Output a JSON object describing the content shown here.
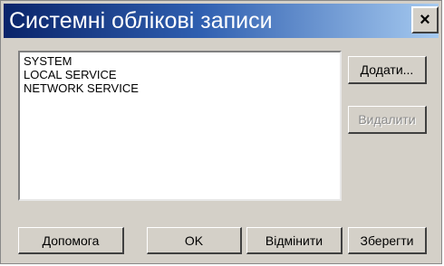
{
  "window": {
    "title": "Системні облікові записи",
    "close_label": "×"
  },
  "accounts": {
    "items": [
      "SYSTEM",
      "LOCAL SERVICE",
      "NETWORK SERVICE"
    ]
  },
  "side_buttons": {
    "add_label": "Додати...",
    "remove_label": "Видалити"
  },
  "footer_buttons": {
    "help_label": "Допомога",
    "ok_label": "OK",
    "cancel_label": "Відмінити",
    "save_label": "Зберегти"
  },
  "colors": {
    "title_start": "#0a246a",
    "title_end": "#a6caf0",
    "face": "#d4d0c8"
  }
}
